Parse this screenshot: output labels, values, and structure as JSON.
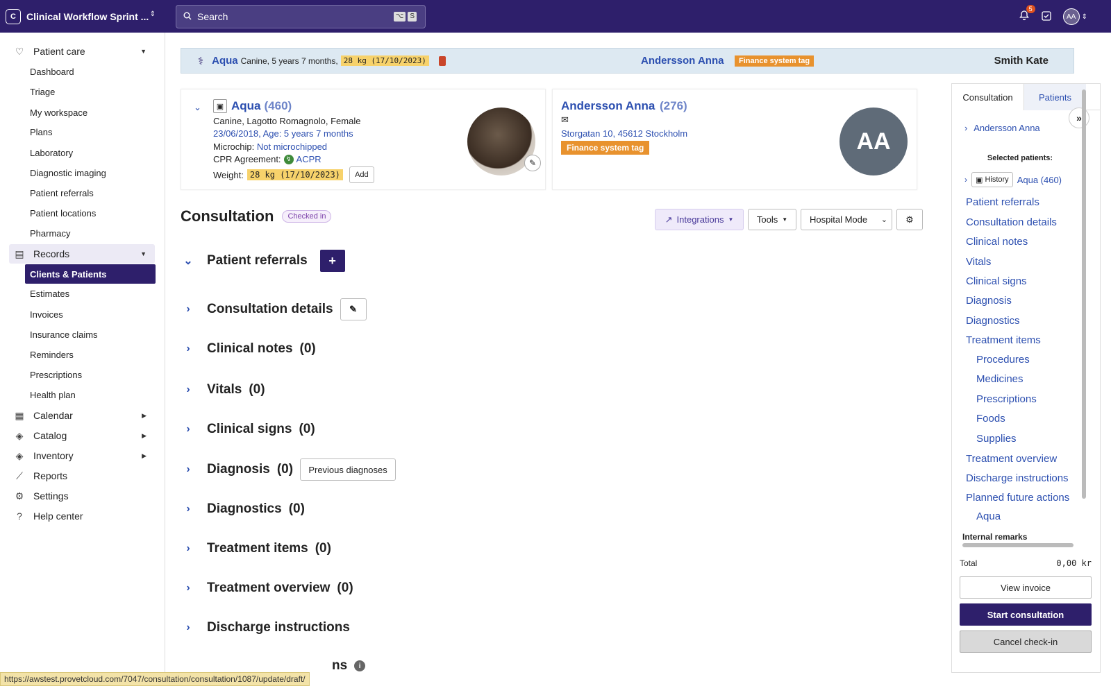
{
  "header": {
    "org_initial": "C",
    "org_name": "Clinical Workflow Sprint ...",
    "search_placeholder": "Search",
    "search_kbd_1": "⌥",
    "search_kbd_2": "S",
    "notification_count": "5",
    "user_initials": "AA"
  },
  "sidebar": {
    "patient_care": "Patient care",
    "patient_care_items": [
      "Dashboard",
      "Triage",
      "My workspace",
      "Plans",
      "Laboratory",
      "Diagnostic imaging",
      "Patient referrals",
      "Patient locations",
      "Pharmacy"
    ],
    "records": "Records",
    "records_items": [
      "Clients & Patients",
      "Estimates",
      "Invoices",
      "Insurance claims",
      "Reminders",
      "Prescriptions",
      "Health plan"
    ],
    "calendar": "Calendar",
    "catalog": "Catalog",
    "inventory": "Inventory",
    "reports": "Reports",
    "settings": "Settings",
    "help": "Help center"
  },
  "patient_bar": {
    "name": "Aqua",
    "details": "Canine, 5 years 7 months,",
    "weight": "28 kg (17/10/2023)",
    "owner": "Andersson Anna",
    "tag": "Finance system tag",
    "vet": "Smith Kate"
  },
  "patient_card": {
    "name": "Aqua",
    "id": "(460)",
    "species": "Canine, Lagotto Romagnolo, Female",
    "dob": "23/06/2018, Age: 5 years 7 months",
    "microchip_label": "Microchip:",
    "microchip_value": "Not microchipped",
    "cpr_label": "CPR Agreement:",
    "cpr_value": "ACPR",
    "weight_label": "Weight:",
    "weight_value": "28 kg (17/10/2023)",
    "add_label": "Add"
  },
  "client_card": {
    "name": "Andersson Anna",
    "id": "(276)",
    "address": "Storgatan 10, 45612 Stockholm",
    "tag": "Finance system tag",
    "initials": "AA"
  },
  "consultation": {
    "title": "Consultation",
    "status": "Checked in",
    "integrations": "Integrations",
    "tools": "Tools",
    "mode": "Hospital Mode",
    "sections": [
      {
        "label": "Patient referrals",
        "count": ""
      },
      {
        "label": "Consultation details",
        "count": ""
      },
      {
        "label": "Clinical notes",
        "count": "(0)"
      },
      {
        "label": "Vitals",
        "count": "(0)"
      },
      {
        "label": "Clinical signs",
        "count": "(0)"
      },
      {
        "label": "Diagnosis",
        "count": "(0)"
      },
      {
        "label": "Diagnostics",
        "count": "(0)"
      },
      {
        "label": "Treatment items",
        "count": "(0)"
      },
      {
        "label": "Treatment overview",
        "count": "(0)"
      },
      {
        "label": "Discharge instructions",
        "count": ""
      },
      {
        "label": "ns",
        "count": ""
      }
    ],
    "previous_diagnoses": "Previous diagnoses"
  },
  "right_panel": {
    "tab_consultation": "Consultation",
    "tab_patients": "Patients",
    "client": "Andersson Anna",
    "selected_patients": "Selected patients:",
    "history": "History",
    "patient": "Aqua (460)",
    "links": [
      "Patient referrals",
      "Consultation details",
      "Clinical notes",
      "Vitals",
      "Clinical signs",
      "Diagnosis",
      "Diagnostics",
      "Treatment items"
    ],
    "sub_links": [
      "Procedures",
      "Medicines",
      "Prescriptions",
      "Foods",
      "Supplies"
    ],
    "links2": [
      "Treatment overview",
      "Discharge instructions",
      "Planned future actions"
    ],
    "sub_aqua": "Aqua",
    "internal_remarks": "Internal remarks",
    "total_label": "Total",
    "total_value": "0,00 kr",
    "view_invoice": "View invoice",
    "start_consultation": "Start consultation",
    "cancel_checkin": "Cancel check-in"
  },
  "status_url": "https://awstest.provetcloud.com/7047/consultation/consultation/1087/update/draft/",
  "colors": {
    "brand": "#2e1f6b",
    "link": "#2c4fb0",
    "tag": "#e8922e",
    "weight_highlight": "#f7d26b"
  }
}
